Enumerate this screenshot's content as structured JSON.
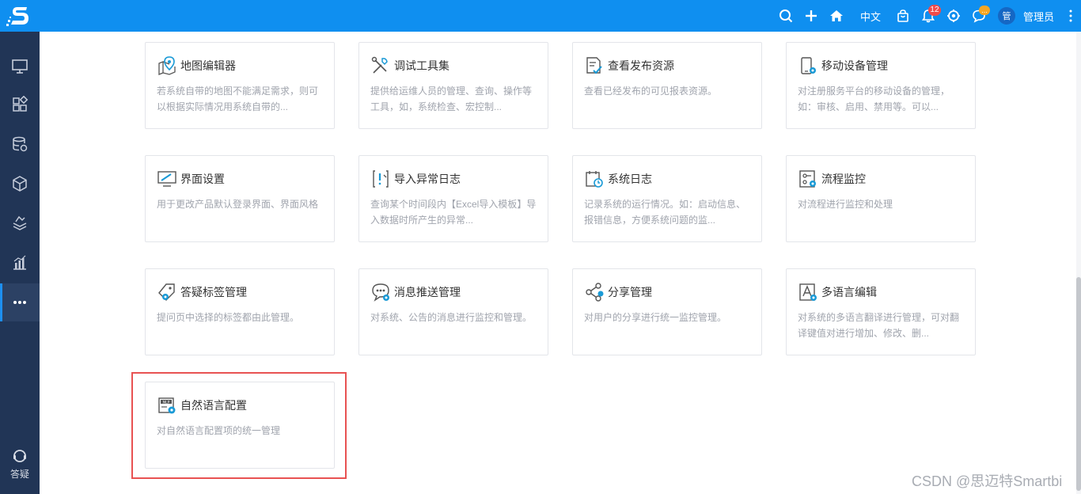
{
  "header": {
    "lang_label": "中文",
    "notification_count": "12",
    "message_badge": "...",
    "avatar_text": "管",
    "username": "管理员",
    "accent_color": "#0f8ff0"
  },
  "sidebar": {
    "background": "#213556",
    "items": [
      {
        "icon": "monitor-icon"
      },
      {
        "icon": "modules-icon"
      },
      {
        "icon": "database-settings-icon"
      },
      {
        "icon": "cube-icon"
      },
      {
        "icon": "layers-icon"
      },
      {
        "icon": "bar-chart-icon"
      },
      {
        "icon": "more-icon",
        "active": true
      }
    ],
    "help_label": "答疑"
  },
  "cards": [
    {
      "title": "地图编辑器",
      "desc": "若系统自带的地图不能满足需求，则可以根据实际情况用系统自带的...",
      "icon": "map-editor-icon"
    },
    {
      "title": "调试工具集",
      "desc": "提供给运维人员的管理、查询、操作等工具，如，系统检查、宏控制...",
      "icon": "debug-tools-icon"
    },
    {
      "title": "查看发布资源",
      "desc": "查看已经发布的可见报表资源。",
      "icon": "published-resources-icon"
    },
    {
      "title": "移动设备管理",
      "desc": "对注册服务平台的移动设备的管理，如：审核、启用、禁用等。可以...",
      "icon": "mobile-device-icon"
    },
    {
      "title": "界面设置",
      "desc": "用于更改产品默认登录界面、界面风格",
      "icon": "interface-settings-icon"
    },
    {
      "title": "导入异常日志",
      "desc": "查询某个时间段内【Excel导入模板】导入数据时所产生的异常...",
      "icon": "import-error-log-icon"
    },
    {
      "title": "系统日志",
      "desc": "记录系统的运行情况。如：启动信息、报错信息，方便系统问题的监...",
      "icon": "system-log-icon"
    },
    {
      "title": "流程监控",
      "desc": "对流程进行监控和处理",
      "icon": "process-monitor-icon"
    },
    {
      "title": "答疑标签管理",
      "desc": "提问页中选择的标签都由此管理。",
      "icon": "qa-tag-icon"
    },
    {
      "title": "消息推送管理",
      "desc": "对系统、公告的消息进行监控和管理。",
      "icon": "message-push-icon"
    },
    {
      "title": "分享管理",
      "desc": "对用户的分享进行统一监控管理。",
      "icon": "share-icon"
    },
    {
      "title": "多语言编辑",
      "desc": "对系统的多语言翻译进行管理，可对翻译键值对进行增加、修改、删...",
      "icon": "multilang-icon"
    },
    {
      "title": "自然语言配置",
      "desc": "对自然语言配置项的统一管理",
      "icon": "nlp-config-icon"
    }
  ],
  "highlight_color": "#e85252",
  "watermark": "CSDN @思迈特Smartbi"
}
